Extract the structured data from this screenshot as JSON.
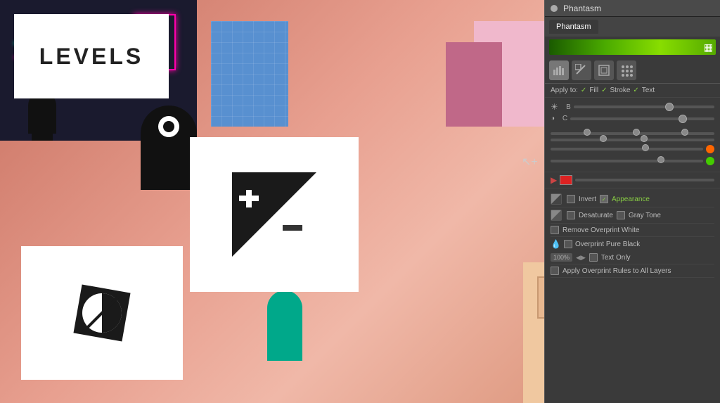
{
  "scene": {
    "title": "Levels",
    "levels_label": "LEVELS"
  },
  "phantasm": {
    "title": "Phantasm",
    "tab_label": "Phantasm",
    "close_button": "×",
    "menu_button": "≡",
    "toolbar": {
      "histogram_icon": "histogram",
      "levels_icon": "levels",
      "curves_icon": "curves",
      "halftone_icon": "halftone"
    },
    "apply_to": {
      "label": "Apply to:",
      "fill": "Fill",
      "stroke": "Stroke",
      "text": "Text"
    },
    "sliders": {
      "b_label": "B",
      "c_label": "C",
      "brightness_label": "☀"
    },
    "options": {
      "invert_label": "Invert",
      "appearance_label": "Appearance",
      "desaturate_label": "Desaturate",
      "gray_tone_label": "Gray Tone",
      "remove_overprint_white": "Remove Overprint White",
      "overprint_pure_black": "Overprint Pure Black",
      "percent": "100%",
      "text_only": "Text Only",
      "apply_overprint": "Apply Overprint Rules to All Layers"
    }
  },
  "icons": {
    "histogram": "▦",
    "levels_slash": "⟋",
    "curves": "⬜",
    "grid": "⠿",
    "cursor": "↖",
    "cursor_plus": "↗",
    "arrow": "▶",
    "dropper": "💧",
    "levels_icon_char": "⊞"
  }
}
